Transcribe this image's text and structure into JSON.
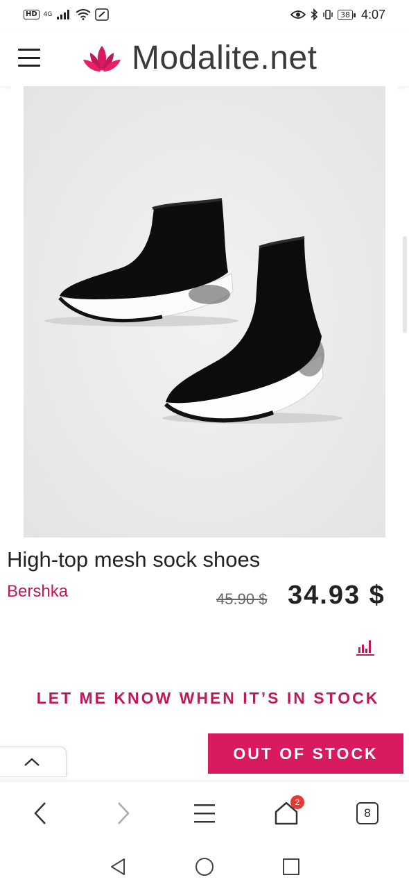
{
  "status_bar": {
    "left_box": "HD",
    "network": "4G",
    "battery": "38",
    "time": "4:07"
  },
  "header": {
    "site_name": "Modalite.net",
    "logo_color": "#d81b60"
  },
  "product": {
    "title": "High-top mesh sock shoes",
    "brand": "Bershka",
    "old_price": "45.90 $",
    "price": "34.93 $",
    "notify_label": "LET ME KNOW WHEN IT’S IN STOCK",
    "cta_label": "OUT OF STOCK",
    "accent_color": "#c2185b"
  },
  "browser_bar": {
    "cart_badge": "2",
    "tabs_count": "8",
    "icons": [
      "back-icon",
      "forward-icon",
      "menu-icon",
      "home-icon",
      "tabs-icon"
    ]
  },
  "system_nav": {
    "icons": [
      "back-triangle-icon",
      "home-circle-icon",
      "recents-square-icon"
    ]
  }
}
